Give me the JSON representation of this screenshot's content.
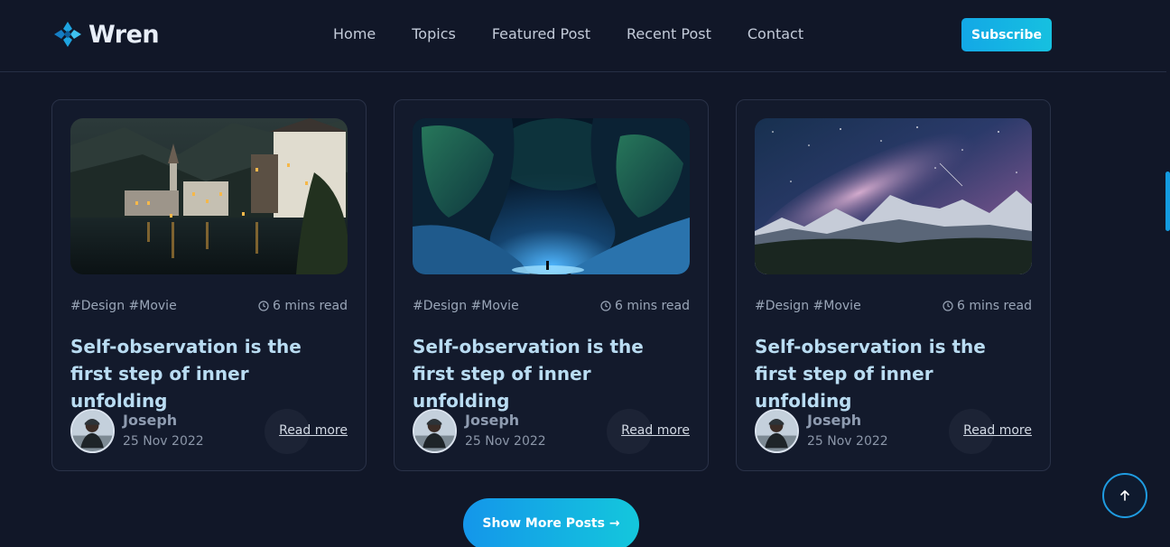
{
  "brand": {
    "name": "Wren",
    "accent": "#13a8e6"
  },
  "nav": {
    "items": [
      {
        "label": "Home"
      },
      {
        "label": "Topics"
      },
      {
        "label": "Featured Post"
      },
      {
        "label": "Recent Post"
      },
      {
        "label": "Contact"
      }
    ],
    "subscribe_label": "Subscribe"
  },
  "posts": [
    {
      "image": "lakeside-village-night",
      "tags": "#Design #Movie",
      "read_time": "6 mins read",
      "title": "Self-observation is the first step of inner unfolding",
      "author": "Joseph",
      "date": "25 Nov 2022",
      "cta": "Read more"
    },
    {
      "image": "aurora-canyon",
      "tags": "#Design #Movie",
      "read_time": "6 mins read",
      "title": "Self-observation is the first step of inner unfolding",
      "author": "Joseph",
      "date": "25 Nov 2022",
      "cta": "Read more"
    },
    {
      "image": "milky-way-mountains",
      "tags": "#Design #Movie",
      "read_time": "6 mins read",
      "title": "Self-observation is the first step of inner unfolding",
      "author": "Joseph",
      "date": "25 Nov 2022",
      "cta": "Read more"
    }
  ],
  "show_more_label": "Show More Posts →",
  "icons": {
    "clock": "clock-icon",
    "back_to_top": "arrow-up-icon",
    "logo": "logo-mark-icon"
  }
}
